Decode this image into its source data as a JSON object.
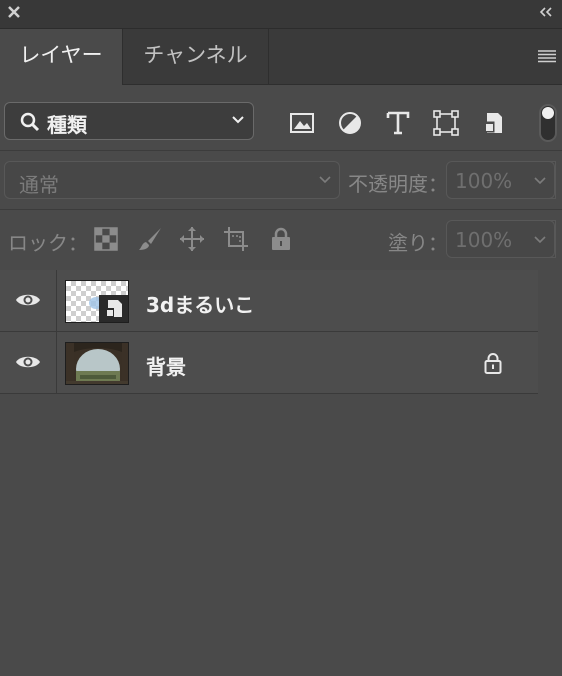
{
  "tabs": {
    "active": "レイヤー",
    "inactive": "チャンネル"
  },
  "filter": {
    "kind_label": "種類"
  },
  "blend": {
    "mode": "通常",
    "opacity_label": "不透明度：",
    "opacity_value": "100%"
  },
  "lock": {
    "label": "ロック：",
    "fill_label": "塗り：",
    "fill_value": "100%"
  },
  "layers": [
    {
      "name": "3dまるいこ",
      "visible": true,
      "smart_object": true,
      "locked": false
    },
    {
      "name": "背景",
      "visible": true,
      "smart_object": false,
      "locked": true
    }
  ],
  "colors": {
    "panel_bg": "#4a4a4a",
    "tab_bar_bg": "#3a3a3a",
    "text": "#f0f0f0",
    "dim_text": "#878787"
  }
}
